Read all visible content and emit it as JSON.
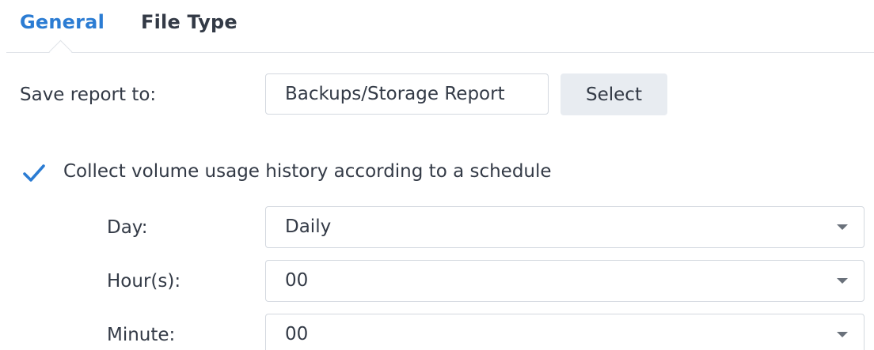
{
  "tabs": [
    {
      "label": "General",
      "active": true
    },
    {
      "label": "File Type",
      "active": false
    }
  ],
  "save_report": {
    "label": "Save report to:",
    "value": "Backups/Storage Report",
    "select_label": "Select"
  },
  "collect": {
    "label": "Collect volume usage history according to a schedule",
    "checked": true
  },
  "schedule": {
    "day": {
      "label": "Day:",
      "value": "Daily"
    },
    "hours": {
      "label": "Hour(s):",
      "value": "00"
    },
    "minute": {
      "label": "Minute:",
      "value": "00"
    }
  },
  "colors": {
    "accent": "#2b7cd3",
    "text": "#333a46",
    "border": "#d3d8df",
    "button_bg": "#e8ecf1"
  },
  "icons": {
    "checkbox": "checkmark-icon",
    "dropdown": "caret-down-icon"
  }
}
